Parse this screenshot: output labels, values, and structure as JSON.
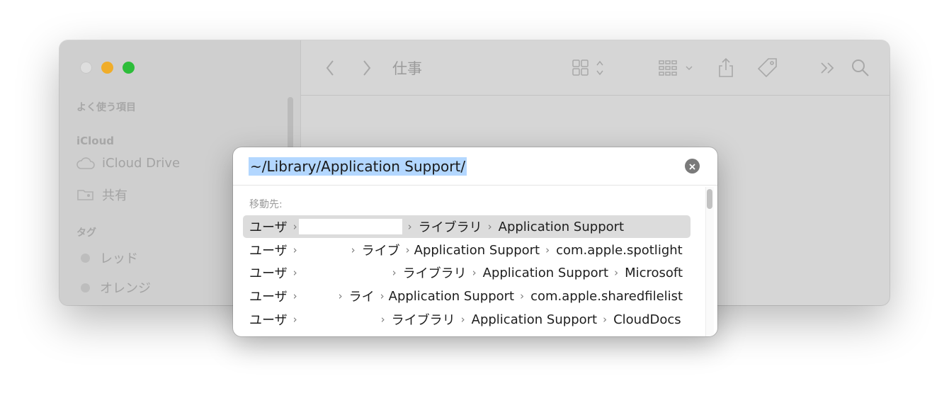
{
  "sidebar": {
    "favorites_header": "よく使う項目",
    "icloud_header": "iCloud",
    "icloud_drive": "iCloud Drive",
    "shared": "共有",
    "tags_header": "タグ",
    "tag_red": "レッド",
    "tag_orange": "オレンジ"
  },
  "toolbar": {
    "title": "仕事"
  },
  "goto": {
    "path_value": "~/Library/Application Support/",
    "label": "移動先:",
    "rows": [
      [
        "ユーザ",
        "",
        "ライブラリ",
        "Application Support"
      ],
      [
        "ユーザ",
        "",
        "ライブ",
        "Application Support",
        "com.apple.spotlight"
      ],
      [
        "ユーザ",
        "",
        "ライブラリ",
        "Application Support",
        "Microsoft"
      ],
      [
        "ユーザ",
        "",
        "ライ",
        "Application Support",
        "com.apple.sharedfilelist"
      ],
      [
        "ユーザ",
        "",
        "ライブラリ",
        "Application Support",
        "CloudDocs"
      ]
    ]
  }
}
